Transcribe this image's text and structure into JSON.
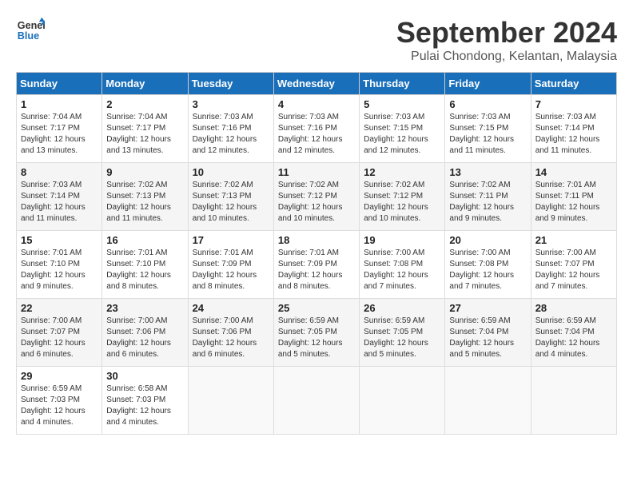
{
  "logo": {
    "line1": "General",
    "line2": "Blue"
  },
  "title": "September 2024",
  "subtitle": "Pulai Chondong, Kelantan, Malaysia",
  "headers": [
    "Sunday",
    "Monday",
    "Tuesday",
    "Wednesday",
    "Thursday",
    "Friday",
    "Saturday"
  ],
  "weeks": [
    [
      {
        "day": "1",
        "sunrise": "Sunrise: 7:04 AM",
        "sunset": "Sunset: 7:17 PM",
        "daylight": "Daylight: 12 hours and 13 minutes."
      },
      {
        "day": "2",
        "sunrise": "Sunrise: 7:04 AM",
        "sunset": "Sunset: 7:17 PM",
        "daylight": "Daylight: 12 hours and 13 minutes."
      },
      {
        "day": "3",
        "sunrise": "Sunrise: 7:03 AM",
        "sunset": "Sunset: 7:16 PM",
        "daylight": "Daylight: 12 hours and 12 minutes."
      },
      {
        "day": "4",
        "sunrise": "Sunrise: 7:03 AM",
        "sunset": "Sunset: 7:16 PM",
        "daylight": "Daylight: 12 hours and 12 minutes."
      },
      {
        "day": "5",
        "sunrise": "Sunrise: 7:03 AM",
        "sunset": "Sunset: 7:15 PM",
        "daylight": "Daylight: 12 hours and 12 minutes."
      },
      {
        "day": "6",
        "sunrise": "Sunrise: 7:03 AM",
        "sunset": "Sunset: 7:15 PM",
        "daylight": "Daylight: 12 hours and 11 minutes."
      },
      {
        "day": "7",
        "sunrise": "Sunrise: 7:03 AM",
        "sunset": "Sunset: 7:14 PM",
        "daylight": "Daylight: 12 hours and 11 minutes."
      }
    ],
    [
      {
        "day": "8",
        "sunrise": "Sunrise: 7:03 AM",
        "sunset": "Sunset: 7:14 PM",
        "daylight": "Daylight: 12 hours and 11 minutes."
      },
      {
        "day": "9",
        "sunrise": "Sunrise: 7:02 AM",
        "sunset": "Sunset: 7:13 PM",
        "daylight": "Daylight: 12 hours and 11 minutes."
      },
      {
        "day": "10",
        "sunrise": "Sunrise: 7:02 AM",
        "sunset": "Sunset: 7:13 PM",
        "daylight": "Daylight: 12 hours and 10 minutes."
      },
      {
        "day": "11",
        "sunrise": "Sunrise: 7:02 AM",
        "sunset": "Sunset: 7:12 PM",
        "daylight": "Daylight: 12 hours and 10 minutes."
      },
      {
        "day": "12",
        "sunrise": "Sunrise: 7:02 AM",
        "sunset": "Sunset: 7:12 PM",
        "daylight": "Daylight: 12 hours and 10 minutes."
      },
      {
        "day": "13",
        "sunrise": "Sunrise: 7:02 AM",
        "sunset": "Sunset: 7:11 PM",
        "daylight": "Daylight: 12 hours and 9 minutes."
      },
      {
        "day": "14",
        "sunrise": "Sunrise: 7:01 AM",
        "sunset": "Sunset: 7:11 PM",
        "daylight": "Daylight: 12 hours and 9 minutes."
      }
    ],
    [
      {
        "day": "15",
        "sunrise": "Sunrise: 7:01 AM",
        "sunset": "Sunset: 7:10 PM",
        "daylight": "Daylight: 12 hours and 9 minutes."
      },
      {
        "day": "16",
        "sunrise": "Sunrise: 7:01 AM",
        "sunset": "Sunset: 7:10 PM",
        "daylight": "Daylight: 12 hours and 8 minutes."
      },
      {
        "day": "17",
        "sunrise": "Sunrise: 7:01 AM",
        "sunset": "Sunset: 7:09 PM",
        "daylight": "Daylight: 12 hours and 8 minutes."
      },
      {
        "day": "18",
        "sunrise": "Sunrise: 7:01 AM",
        "sunset": "Sunset: 7:09 PM",
        "daylight": "Daylight: 12 hours and 8 minutes."
      },
      {
        "day": "19",
        "sunrise": "Sunrise: 7:00 AM",
        "sunset": "Sunset: 7:08 PM",
        "daylight": "Daylight: 12 hours and 7 minutes."
      },
      {
        "day": "20",
        "sunrise": "Sunrise: 7:00 AM",
        "sunset": "Sunset: 7:08 PM",
        "daylight": "Daylight: 12 hours and 7 minutes."
      },
      {
        "day": "21",
        "sunrise": "Sunrise: 7:00 AM",
        "sunset": "Sunset: 7:07 PM",
        "daylight": "Daylight: 12 hours and 7 minutes."
      }
    ],
    [
      {
        "day": "22",
        "sunrise": "Sunrise: 7:00 AM",
        "sunset": "Sunset: 7:07 PM",
        "daylight": "Daylight: 12 hours and 6 minutes."
      },
      {
        "day": "23",
        "sunrise": "Sunrise: 7:00 AM",
        "sunset": "Sunset: 7:06 PM",
        "daylight": "Daylight: 12 hours and 6 minutes."
      },
      {
        "day": "24",
        "sunrise": "Sunrise: 7:00 AM",
        "sunset": "Sunset: 7:06 PM",
        "daylight": "Daylight: 12 hours and 6 minutes."
      },
      {
        "day": "25",
        "sunrise": "Sunrise: 6:59 AM",
        "sunset": "Sunset: 7:05 PM",
        "daylight": "Daylight: 12 hours and 5 minutes."
      },
      {
        "day": "26",
        "sunrise": "Sunrise: 6:59 AM",
        "sunset": "Sunset: 7:05 PM",
        "daylight": "Daylight: 12 hours and 5 minutes."
      },
      {
        "day": "27",
        "sunrise": "Sunrise: 6:59 AM",
        "sunset": "Sunset: 7:04 PM",
        "daylight": "Daylight: 12 hours and 5 minutes."
      },
      {
        "day": "28",
        "sunrise": "Sunrise: 6:59 AM",
        "sunset": "Sunset: 7:04 PM",
        "daylight": "Daylight: 12 hours and 4 minutes."
      }
    ],
    [
      {
        "day": "29",
        "sunrise": "Sunrise: 6:59 AM",
        "sunset": "Sunset: 7:03 PM",
        "daylight": "Daylight: 12 hours and 4 minutes."
      },
      {
        "day": "30",
        "sunrise": "Sunrise: 6:58 AM",
        "sunset": "Sunset: 7:03 PM",
        "daylight": "Daylight: 12 hours and 4 minutes."
      },
      null,
      null,
      null,
      null,
      null
    ]
  ]
}
